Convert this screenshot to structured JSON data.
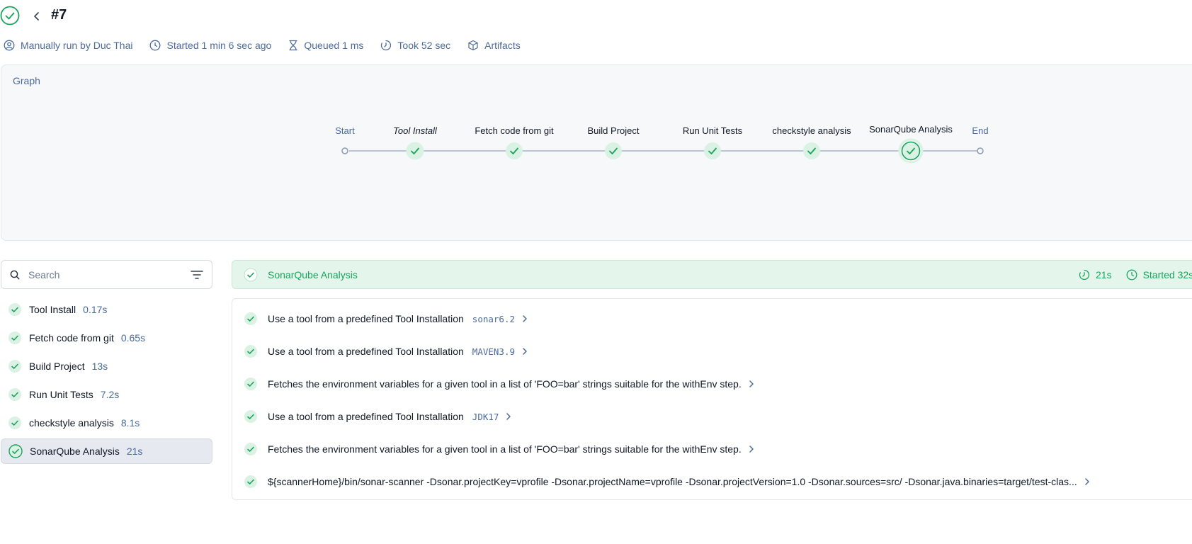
{
  "run": {
    "number": "#7",
    "status": "success"
  },
  "meta": {
    "trigger": "Manually run by Duc Thai",
    "started": "Started 1 min 6 sec ago",
    "queued": "Queued 1 ms",
    "took": "Took 52 sec",
    "artifacts": "Artifacts"
  },
  "graph": {
    "label": "Graph",
    "start": "Start",
    "end": "End",
    "stages": [
      "Tool Install",
      "Fetch code from git",
      "Build Project",
      "Run Unit Tests",
      "checkstyle analysis",
      "SonarQube Analysis"
    ]
  },
  "search": {
    "placeholder": "Search"
  },
  "stage_list": [
    {
      "name": "Tool Install",
      "duration": "0.17s"
    },
    {
      "name": "Fetch code from git",
      "duration": "0.65s"
    },
    {
      "name": "Build Project",
      "duration": "13s"
    },
    {
      "name": "Run Unit Tests",
      "duration": "7.2s"
    },
    {
      "name": "checkstyle analysis",
      "duration": "8.1s"
    },
    {
      "name": "SonarQube Analysis",
      "duration": "21s"
    }
  ],
  "selected_stage": {
    "title": "SonarQube Analysis",
    "duration": "21s",
    "started": "Started 32s"
  },
  "steps": [
    {
      "text": "Use a tool from a predefined Tool Installation",
      "code": "sonar6.2"
    },
    {
      "text": "Use a tool from a predefined Tool Installation",
      "code": "MAVEN3.9"
    },
    {
      "text": "Fetches the environment variables for a given tool in a list of 'FOO=bar' strings suitable for the withEnv step.",
      "code": ""
    },
    {
      "text": "Use a tool from a predefined Tool Installation",
      "code": "JDK17"
    },
    {
      "text": "Fetches the environment variables for a given tool in a list of 'FOO=bar' strings suitable for the withEnv step.",
      "code": ""
    },
    {
      "text": "${scannerHome}/bin/sonar-scanner -Dsonar.projectKey=vprofile -Dsonar.projectName=vprofile -Dsonar.projectVersion=1.0 -Dsonar.sources=src/ -Dsonar.java.binaries=target/test-clas...",
      "code": ""
    }
  ],
  "colors": {
    "success": "#1aa35b",
    "success_bg": "#e4f6ec",
    "muted": "#4b6a9b",
    "line": "#b8c4d4"
  }
}
